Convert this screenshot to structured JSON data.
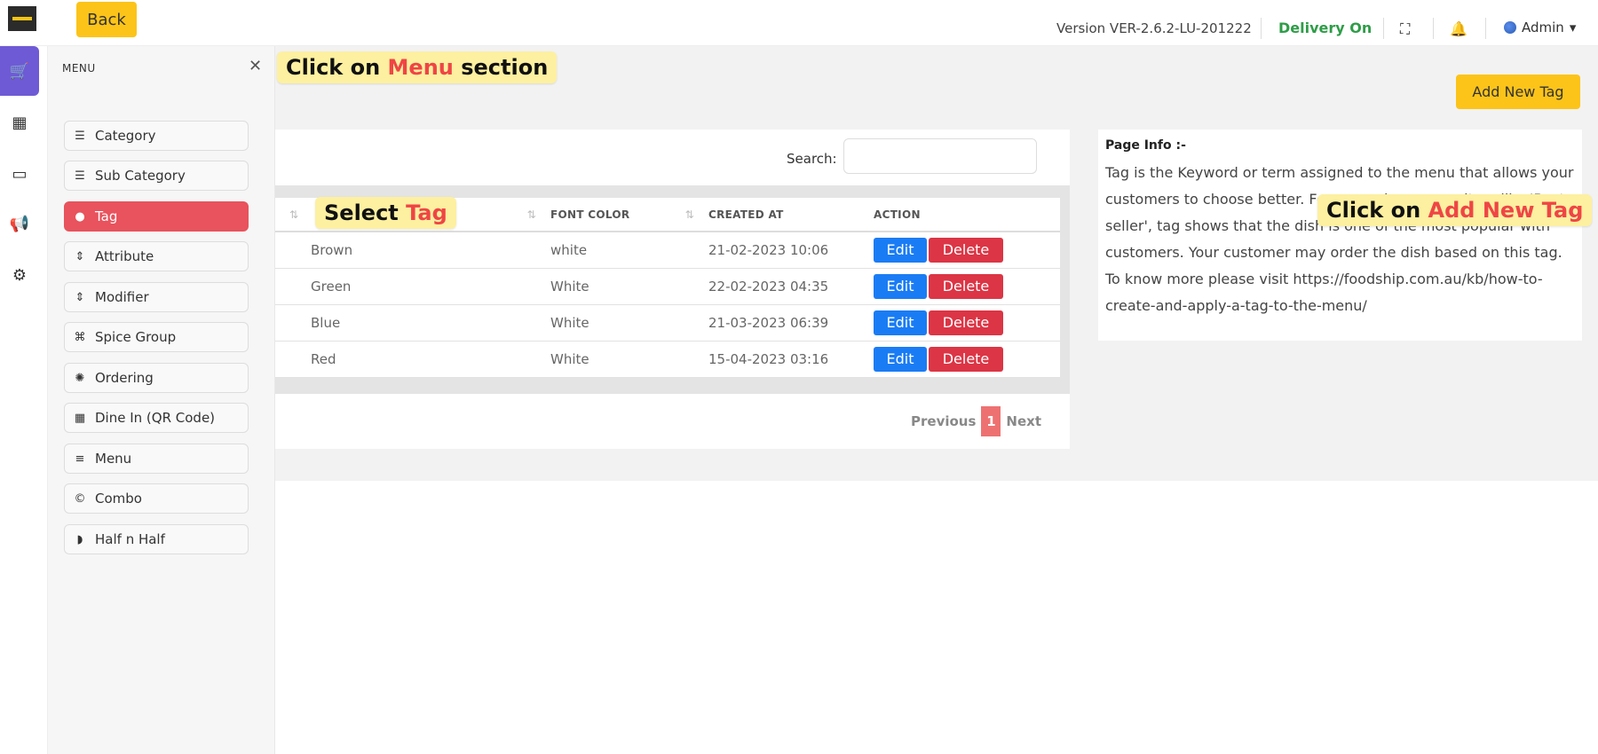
{
  "header": {
    "back_label": "Back",
    "version": "Version VER-2.6.2-LU-201222",
    "delivery_status": "Delivery On",
    "user": "Admin"
  },
  "rail": {
    "items": [
      {
        "icon": "cart-icon",
        "glyph": "🛒"
      },
      {
        "icon": "calculator-icon",
        "glyph": "▦"
      },
      {
        "icon": "monitor-icon",
        "glyph": "▭"
      },
      {
        "icon": "megaphone-icon",
        "glyph": "📢"
      },
      {
        "icon": "gear-icon",
        "glyph": "⚙"
      }
    ]
  },
  "menu": {
    "title": "MENU",
    "items": [
      {
        "label": "Category",
        "icon": "list-icon",
        "glyph": "☰"
      },
      {
        "label": "Sub Category",
        "icon": "list-icon",
        "glyph": "☰"
      },
      {
        "label": "Tag",
        "icon": "tag-icon",
        "glyph": "🏷"
      },
      {
        "label": "Attribute",
        "icon": "sort-icon",
        "glyph": "⇕"
      },
      {
        "label": "Modifier",
        "icon": "sort-icon",
        "glyph": "⇕"
      },
      {
        "label": "Spice Group",
        "icon": "spice-icon",
        "glyph": "⌘"
      },
      {
        "label": "Ordering",
        "icon": "ordering-icon",
        "glyph": "✺"
      },
      {
        "label": "Dine In (QR Code)",
        "icon": "qr-icon",
        "glyph": "▦"
      },
      {
        "label": "Menu",
        "icon": "menu-icon",
        "glyph": "≡"
      },
      {
        "label": "Combo",
        "icon": "combo-icon",
        "glyph": "©"
      },
      {
        "label": "Half n Half",
        "icon": "half-icon",
        "glyph": "◗"
      }
    ]
  },
  "main": {
    "add_button_label": "Add New Tag",
    "search_label": "Search:",
    "columns": [
      "FONT COLOR",
      "CREATED AT",
      "ACTION"
    ],
    "rows": [
      {
        "name": "Brown",
        "font_color": "white",
        "created_at": "21-02-2023 10:06"
      },
      {
        "name": "Green",
        "font_color": "White",
        "created_at": "22-02-2023 04:35"
      },
      {
        "name": "Blue",
        "font_color": "White",
        "created_at": "21-03-2023 06:39"
      },
      {
        "name": "Red",
        "font_color": "White",
        "created_at": "15-04-2023 03:16"
      }
    ],
    "edit_label": "Edit",
    "delete_label": "Delete",
    "pagination": {
      "previous": "Previous",
      "current": "1",
      "next": "Next"
    }
  },
  "info": {
    "title": "Page Info :-",
    "text": "Tag is the Keyword or term assigned to the menu that allows your customers to choose better. For example, a menu item like 'Best seller', tag shows that the dish is one of the most popular with customers. Your customer may order the dish based on this tag. To know more please visit https://foodship.com.au/kb/how-to-create-and-apply-a-tag-to-the-menu/"
  },
  "callouts": {
    "menu": {
      "prefix": "Click on ",
      "highlight": "Menu",
      "suffix": " section"
    },
    "tag": {
      "prefix": "Select ",
      "highlight": "Tag"
    },
    "add": {
      "prefix": "Click on ",
      "highlight": "Add New Tag"
    }
  },
  "colors": {
    "accent_yellow": "#fcc419",
    "active_menu": "#e8535d",
    "rail_active": "#6f5ad6",
    "delivery_green": "#2e9d47",
    "edit_blue": "#1a7cf5",
    "delete_red": "#dc3545"
  }
}
